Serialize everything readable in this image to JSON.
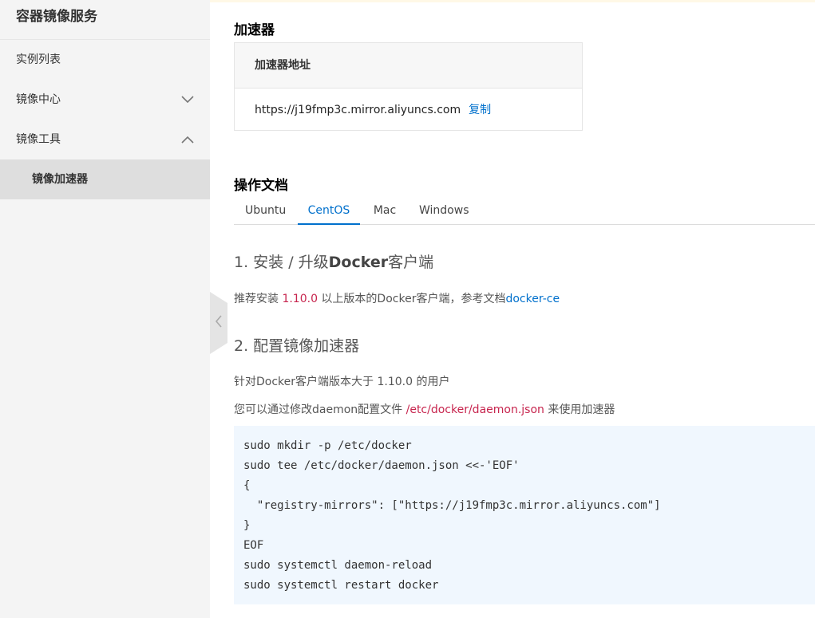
{
  "sidebar": {
    "title": "容器镜像服务",
    "items": [
      {
        "label": "实例列表"
      },
      {
        "label": "镜像中心"
      },
      {
        "label": "镜像工具"
      }
    ],
    "sub_item": "镜像加速器"
  },
  "accelerator": {
    "title": "加速器",
    "header": "加速器地址",
    "url": "https://j19fmp3c.mirror.aliyuncs.com",
    "copy_label": "复制"
  },
  "docs": {
    "title": "操作文档",
    "tabs": [
      "Ubuntu",
      "CentOS",
      "Mac",
      "Windows"
    ],
    "active_tab": "CentOS",
    "step1": {
      "prefix": "1. 安装 / 升级",
      "bold": "Docker",
      "suffix": "客户端",
      "text_before": "推荐安装 ",
      "version": "1.10.0",
      "text_after": " 以上版本的Docker客户端，参考文档",
      "link": "docker-ce"
    },
    "step2": {
      "title": "2. 配置镜像加速器",
      "line1": "针对Docker客户端版本大于 1.10.0 的用户",
      "line2_before": "您可以通过修改daemon配置文件 ",
      "line2_path": "/etc/docker/daemon.json",
      "line2_after": " 来使用加速器"
    },
    "code_lines": [
      "sudo mkdir -p /etc/docker",
      "sudo tee /etc/docker/daemon.json <<-'EOF'",
      "{",
      "  \"registry-mirrors\": [\"https://j19fmp3c.mirror.aliyuncs.com\"]",
      "}",
      "EOF",
      "sudo systemctl daemon-reload",
      "sudo systemctl restart docker"
    ]
  },
  "colors": {
    "link": "#0070cc",
    "accent": "#c7254e",
    "code_bg": "#f0f7fe",
    "sidebar_bg": "#f4f4f4"
  }
}
